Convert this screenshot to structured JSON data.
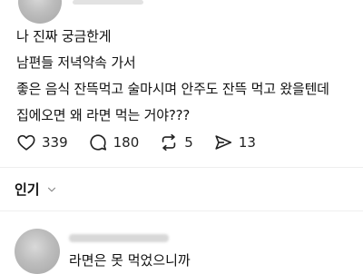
{
  "post": {
    "lines": [
      "나 진짜 궁금한게",
      "남편들 저녁약속 가서",
      "좋은 음식 잔뜩먹고 술마시며 안주도 잔뜩 먹고 왔을텐데",
      "집에오면 왜 라면 먹는 거야???"
    ]
  },
  "actions": {
    "likes": "339",
    "comments": "180",
    "reposts": "5",
    "shares": "13"
  },
  "sort": {
    "label": "인기"
  },
  "comment": {
    "text": "라면은 못 먹었으니까"
  },
  "icons": {
    "like": "heart-icon",
    "comment": "comment-bubble-icon",
    "repost": "repost-icon",
    "share": "send-icon",
    "sort": "chevron-down-icon"
  }
}
